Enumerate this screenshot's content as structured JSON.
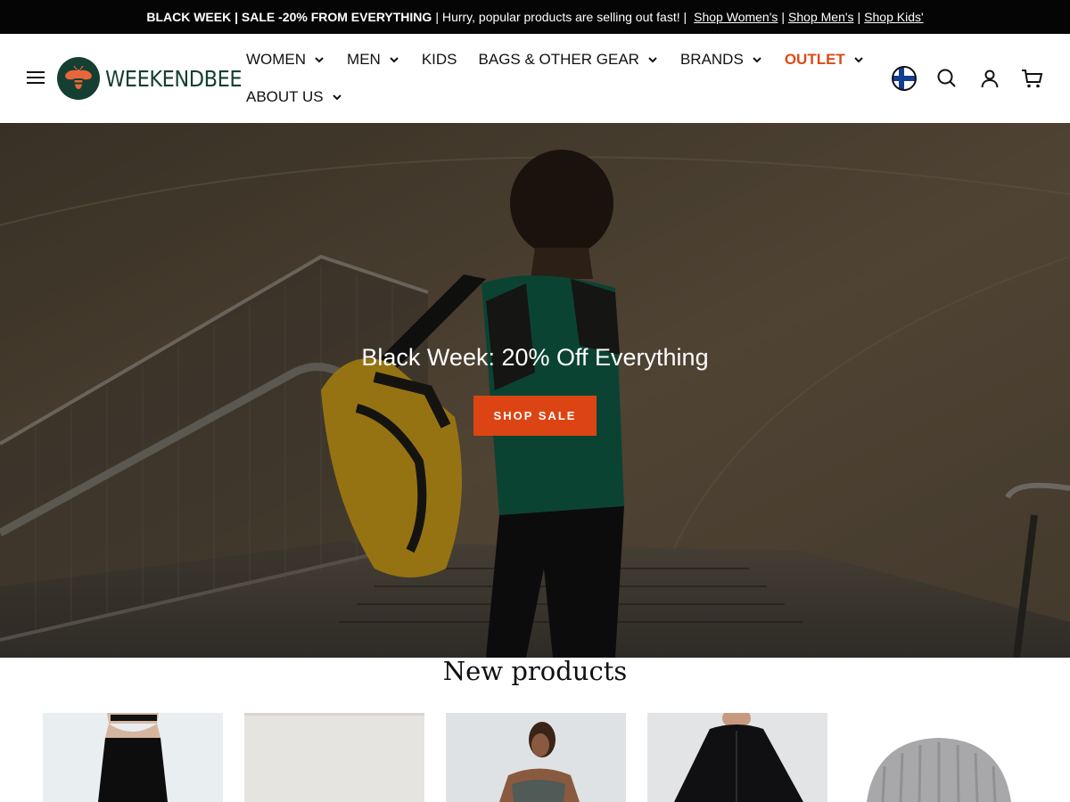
{
  "announcement": {
    "bold": "BLACK WEEK | SALE -20% FROM EVERYTHING",
    "divider": "|",
    "text": "Hurry, popular products are selling out fast! |",
    "links": [
      "Shop Women's",
      "Shop Men's",
      "Shop Kids'"
    ],
    "link_separator": "|"
  },
  "header": {
    "logo_text": "WEEKENDBEE",
    "nav": [
      {
        "label": "WOMEN",
        "dropdown": true
      },
      {
        "label": "MEN",
        "dropdown": true
      },
      {
        "label": "KIDS",
        "dropdown": false
      },
      {
        "label": "BAGS & OTHER GEAR",
        "dropdown": true
      },
      {
        "label": "BRANDS",
        "dropdown": true
      },
      {
        "label": "OUTLET",
        "dropdown": true
      },
      {
        "label": "ABOUT US",
        "dropdown": true
      }
    ],
    "icons": [
      "finland-flag-icon",
      "search-icon",
      "account-icon",
      "cart-icon"
    ]
  },
  "hero": {
    "title": "Black Week: 20% Off Everything",
    "button": "SHOP SALE"
  },
  "new_products": {
    "title": "New products",
    "items": [
      "leggings-product",
      "grey-product",
      "sports-bra-product",
      "black-jacket-product",
      "grey-beanie-product"
    ]
  },
  "colors": {
    "brand_green": "#163f33",
    "accent_orange": "#dc4513",
    "outlet_orange": "#dd4b15",
    "announcement_bg": "#050505"
  }
}
